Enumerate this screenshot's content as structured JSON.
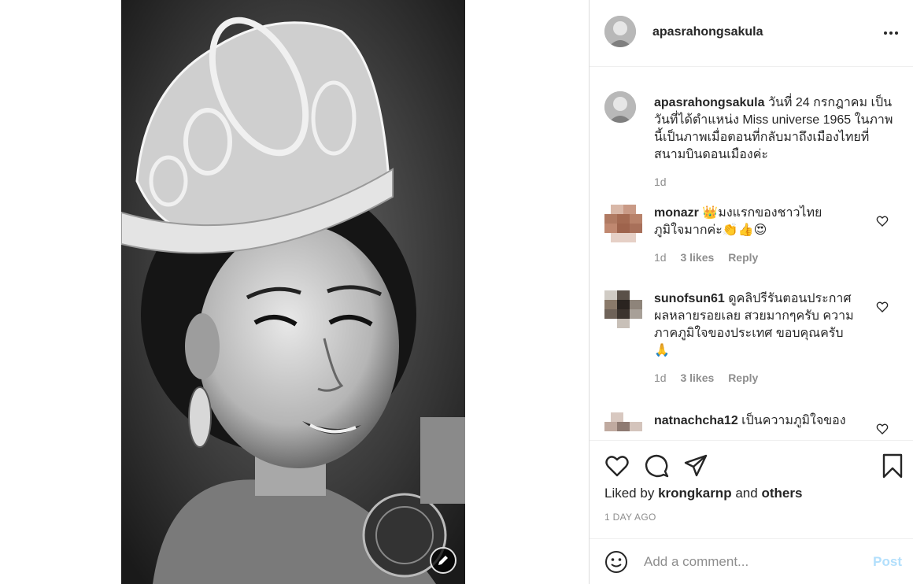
{
  "post": {
    "username": "apasrahongsakula",
    "caption": {
      "username": "apasrahongsakula",
      "text": "วันที่ 24 กรกฎาคม เป็นวันที่ได้ตำแหน่ง Miss universe 1965 ในภาพนี้เป็นภาพเมื่อตอนที่กลับมาถึงเมืองไทยที่สนามบินดอนเมืองค่ะ",
      "time": "1d"
    },
    "comments": [
      {
        "username": "monazr",
        "text": "👑มงแรกของชาวไทย ภูมิใจมากค่ะ👏👍😍",
        "time": "1d",
        "likes": "3 likes",
        "reply": "Reply"
      },
      {
        "username": "sunofsun61",
        "text": "ดูคลิปรีรันตอนประกาศผลหลายรอยเลย สวยมากๆครับ ความภาคภูมิใจของประเทศ ขอบคุณครับ 🙏",
        "time": "1d",
        "likes": "3 likes",
        "reply": "Reply"
      },
      {
        "username": "natnachcha12",
        "text": "เป็นความภูมิใจของ"
      }
    ],
    "liked_by": {
      "prefix": "Liked by",
      "user": "krongkarnp",
      "and": "and",
      "others": "others"
    },
    "post_time": "1 DAY AGO",
    "comment_form": {
      "placeholder": "Add a comment...",
      "post_label": "Post"
    }
  },
  "icons": {
    "more": "more-options-icon",
    "heart": "heart-icon",
    "comment": "comment-icon",
    "share": "share-icon",
    "save": "bookmark-icon",
    "emoji": "emoji-icon",
    "edit": "pencil-icon"
  },
  "colors": {
    "text": "#262626",
    "muted": "#8e8e8e",
    "border": "#dbdbdb",
    "post_button": "#b2dffc"
  }
}
